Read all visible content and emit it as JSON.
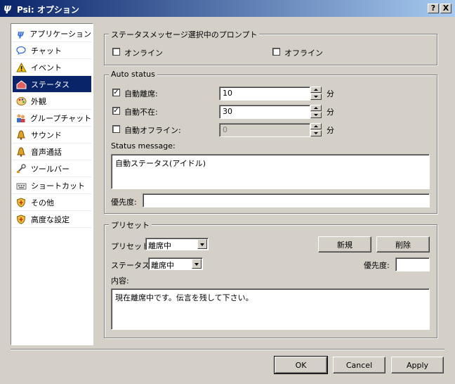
{
  "window": {
    "title": "Psi: オプション",
    "help_btn": "?",
    "close_btn": "X"
  },
  "sidebar": {
    "items": [
      {
        "label": "アプリケーション",
        "icon": "psi-logo-icon"
      },
      {
        "label": "チャット",
        "icon": "speech-bubble-icon"
      },
      {
        "label": "イベント",
        "icon": "warning-icon"
      },
      {
        "label": "ステータス",
        "icon": "status-icon"
      },
      {
        "label": "外観",
        "icon": "palette-icon"
      },
      {
        "label": "グループチャット",
        "icon": "group-icon"
      },
      {
        "label": "サウンド",
        "icon": "bell-icon"
      },
      {
        "label": "音声通話",
        "icon": "bell-icon"
      },
      {
        "label": "ツールバー",
        "icon": "toolbar-icon"
      },
      {
        "label": "ショートカット",
        "icon": "keyboard-icon"
      },
      {
        "label": "その他",
        "icon": "shield-icon"
      },
      {
        "label": "高度な設定",
        "icon": "shield-icon"
      }
    ],
    "selected_index": 3
  },
  "prompt_group": {
    "title": "ステータスメッセージ選択中のプロンプト",
    "online_label": "オンライン",
    "offline_label": "オフライン"
  },
  "auto_status": {
    "title": "Auto status",
    "away": {
      "label": "自動離席:",
      "value": "10",
      "unit": "分",
      "checked": "✓"
    },
    "na": {
      "label": "自動不在:",
      "value": "30",
      "unit": "分",
      "checked": "✓"
    },
    "offline": {
      "label": "自動オフライン:",
      "value": "0",
      "unit": "分",
      "checked": ""
    },
    "status_message_label": "Status message:",
    "status_message_value": "自動ステータス(アイドル)",
    "priority_label": "優先度:",
    "priority_value": ""
  },
  "presets": {
    "title": "プリセット",
    "preset_label": "プリセット:",
    "preset_value": "離席中",
    "new_btn": "新規",
    "delete_btn": "削除",
    "status_label": "ステータス:",
    "status_value": "離席中",
    "priority_label": "優先度:",
    "priority_value": "",
    "content_label": "内容:",
    "content_value": "現在離席中です。伝言を残して下さい。"
  },
  "footer": {
    "ok": "OK",
    "cancel": "Cancel",
    "apply": "Apply"
  },
  "colors": {
    "title_start": "#0a246a",
    "title_end": "#a6caf0",
    "selected": "#0a246a",
    "face": "#d4d0c8"
  }
}
